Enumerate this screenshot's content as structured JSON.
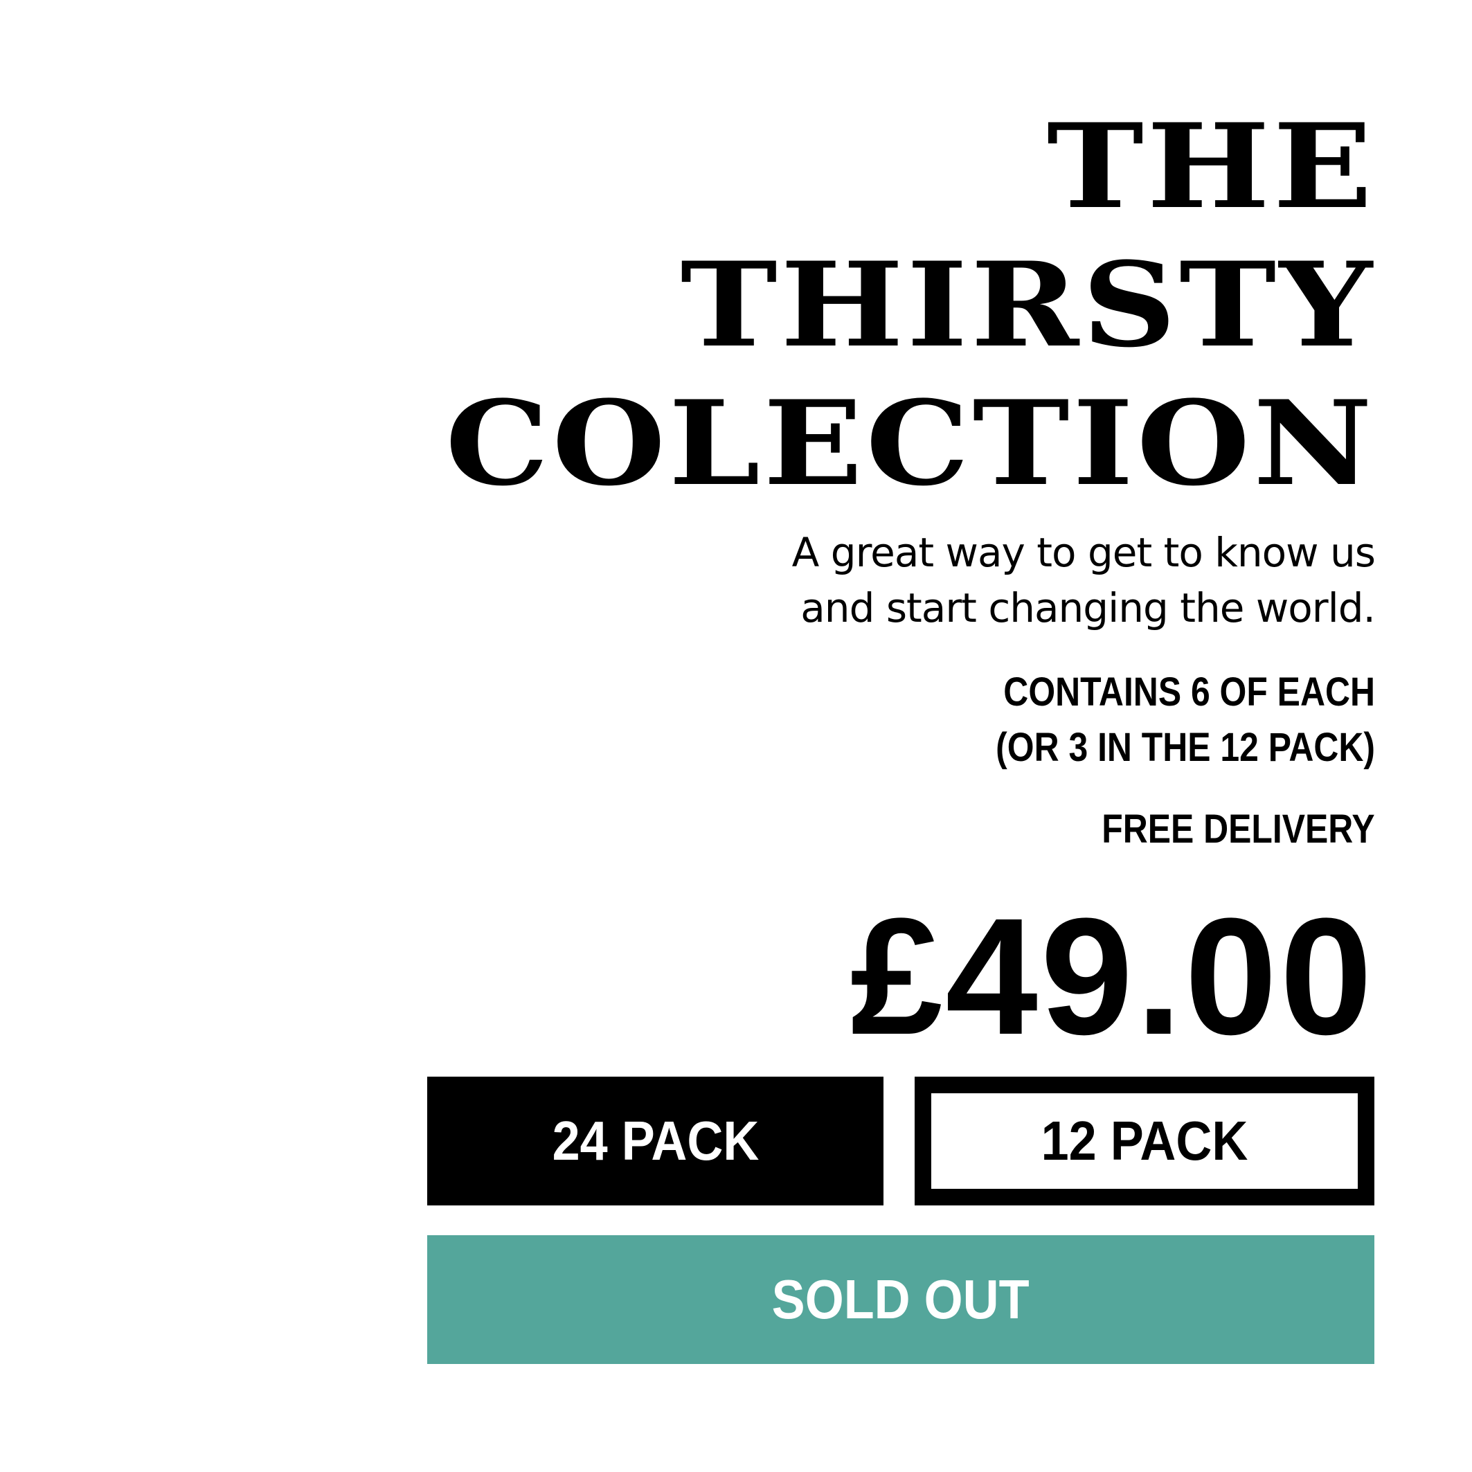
{
  "product": {
    "title_lines": [
      "THE",
      "THIRSTY",
      "COLECTION"
    ],
    "tagline_lines": [
      "A great way to get to know us",
      "and start changing the world."
    ],
    "contents_lines": [
      "CONTAINS 6 OF EACH",
      "(OR 3 IN THE 12 PACK)"
    ],
    "delivery": "FREE DELIVERY",
    "price": "£49.00"
  },
  "pack_options": [
    {
      "label": "24 PACK",
      "selected": true
    },
    {
      "label": "12 PACK",
      "selected": false
    }
  ],
  "sold_out_button": {
    "label": "SOLD OUT",
    "color": "#54a69b"
  },
  "colors": {
    "text": "#000000",
    "background": "#ffffff",
    "accent": "#54a69b"
  }
}
